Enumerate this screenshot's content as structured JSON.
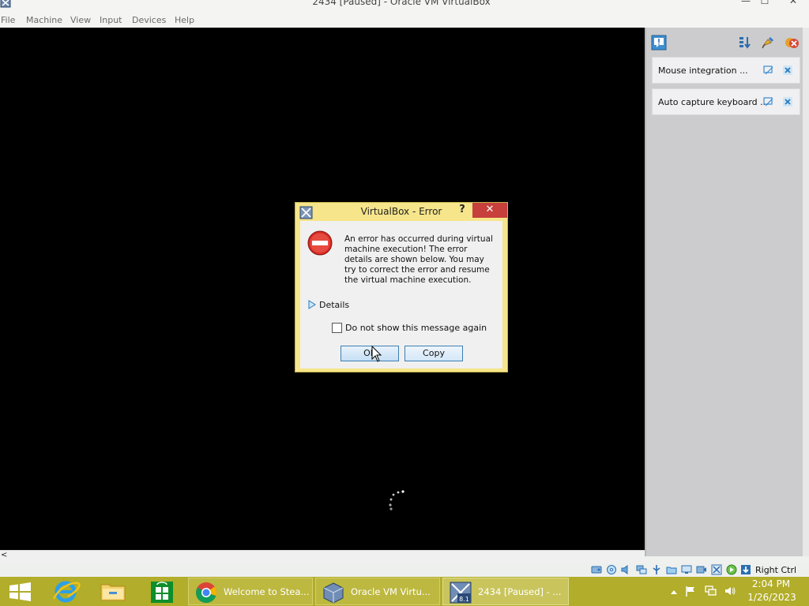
{
  "window": {
    "title": "2434 [Paused] - Oracle VM VirtualBox",
    "minimize_glyph": "—",
    "maximize_glyph": "☐",
    "close_glyph": "✕"
  },
  "menu": [
    "File",
    "Machine",
    "View",
    "Input",
    "Devices",
    "Help"
  ],
  "notifications": {
    "items": [
      {
        "text": "Mouse integration ..."
      },
      {
        "text": "Auto capture keyboard ..."
      }
    ]
  },
  "dialog": {
    "title": "VirtualBox - Error",
    "help_glyph": "?",
    "close_glyph": "✕",
    "message": "An error has occurred during virtual machine execution! The error details are shown below. You may try to correct the error and resume the virtual machine execution.",
    "details_label": "Details",
    "dont_show_label": "Do not show this message again",
    "dont_show_checked": false,
    "ok_label": "OK",
    "copy_label": "Copy"
  },
  "statusbar": {
    "host_key": "Right Ctrl",
    "scroll_left_glyph": "<"
  },
  "taskbar": {
    "tasks": [
      {
        "label": "Welcome to Stea...",
        "icon": "chrome-icon"
      },
      {
        "label": "Oracle VM Virtu...",
        "icon": "virtualbox-icon"
      },
      {
        "label": "2434 [Paused] - ...",
        "icon": "vm-icon",
        "badge": "8.1"
      }
    ],
    "time": "2:04 PM",
    "date": "1/26/2023"
  },
  "colors": {
    "taskbar": "#b2ad2a",
    "dialog_frame": "#f6e58a",
    "close_red": "#c7403b",
    "accent_blue": "#3c7fb1"
  }
}
